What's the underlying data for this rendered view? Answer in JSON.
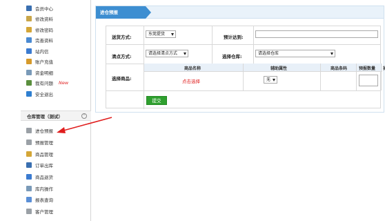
{
  "sidebar": {
    "items": [
      {
        "label": "会员中心",
        "icon": "member-icon",
        "color": "#3a6fb0"
      },
      {
        "label": "修改资料",
        "icon": "edit-icon",
        "color": "#c9a64a"
      },
      {
        "label": "修改密码",
        "icon": "key-icon",
        "color": "#d4a637"
      },
      {
        "label": "完善资料",
        "icon": "document-icon",
        "color": "#4a8ad2"
      },
      {
        "label": "站内信",
        "icon": "speaker-icon",
        "color": "#3b7bd0"
      },
      {
        "label": "账户充值",
        "icon": "wallet-icon",
        "color": "#d69a2b"
      },
      {
        "label": "资金明细",
        "icon": "ledger-icon",
        "color": "#7a9ab8"
      },
      {
        "label": "我有问题",
        "icon": "question-icon",
        "color": "#5a8f3e",
        "badge": "New"
      },
      {
        "label": "安全退出",
        "icon": "exit-icon",
        "color": "#2f7fd0"
      }
    ],
    "section_title": "仓库管理（测试）",
    "warehouse_items": [
      {
        "label": "进仓预报",
        "icon": "inbound-icon",
        "color": "#9aa0a6"
      },
      {
        "label": "预报管理",
        "icon": "forecast-icon",
        "color": "#9aa0a6"
      },
      {
        "label": "商品管理",
        "icon": "goods-icon",
        "color": "#d4a637"
      },
      {
        "label": "订单出库",
        "icon": "outbound-icon",
        "color": "#3a6fb0"
      },
      {
        "label": "商品退货",
        "icon": "return-icon",
        "color": "#3b7bd0"
      },
      {
        "label": "库内操作",
        "icon": "operation-icon",
        "color": "#7a9ab8"
      },
      {
        "label": "报表查询",
        "icon": "report-icon",
        "color": "#5b8fd6"
      },
      {
        "label": "客户管理",
        "icon": "customer-icon",
        "color": "#9aa0a6"
      }
    ]
  },
  "panel": {
    "tab_title": "进仓预报"
  },
  "form": {
    "delivery_label": "送货方式:",
    "delivery_value": "东莞提货",
    "eta_label": "预计达到:",
    "eta_value": "",
    "count_label": "清点方式:",
    "count_value": "请选择清点方式",
    "warehouse_label": "选择仓库:",
    "warehouse_value": "请选择仓库",
    "goods_label": "选择商品:",
    "columns": [
      "商品名称",
      "辅助属性",
      "商品条码",
      "预报数量",
      "操作"
    ],
    "pick_link": "点击选择",
    "attr_value": "无",
    "submit_label": "提交"
  }
}
